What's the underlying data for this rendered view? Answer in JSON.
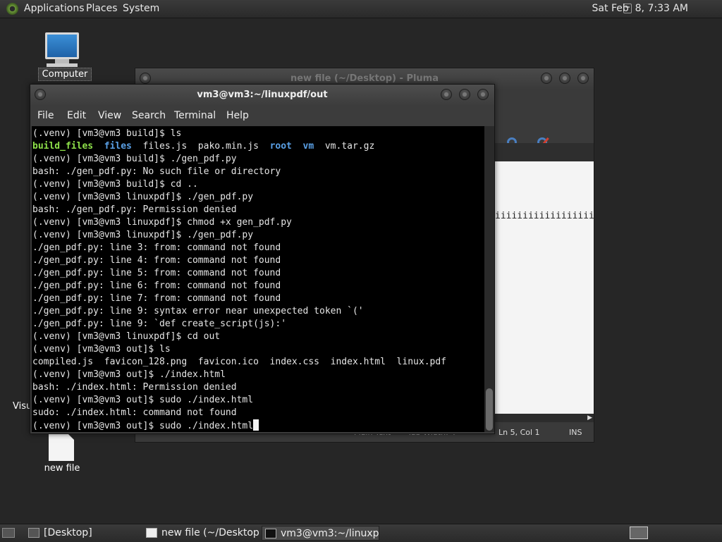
{
  "top_panel": {
    "menus": [
      "Applications",
      "Places",
      "System"
    ],
    "clock": "Sat Feb  8, 7:33 AM"
  },
  "desktop": {
    "computer_label": "Computer",
    "visu_label": "Visu",
    "newfile_label": "new file"
  },
  "pluma": {
    "title": "new file (~/Desktop) - Pluma",
    "text_line": "iiiiiiiiiiiiiiiiiiiii",
    "status": {
      "syntax": "Plain Text",
      "tab_width": "Tab Width:  4",
      "position": "Ln 5, Col 1",
      "mode": "INS"
    }
  },
  "terminal": {
    "title": "vm3@vm3:~/linuxpdf/out",
    "menus": [
      "File",
      "Edit",
      "View",
      "Search",
      "Terminal",
      "Help"
    ],
    "lines": [
      "(.venv) [vm3@vm3 build]$ ls",
      "build_files  files  files.js  pako.min.js  root  vm  vm.tar.gz",
      "(.venv) [vm3@vm3 build]$ ./gen_pdf.py",
      "bash: ./gen_pdf.py: No such file or directory",
      "(.venv) [vm3@vm3 build]$ cd ..",
      "(.venv) [vm3@vm3 linuxpdf]$ ./gen_pdf.py",
      "bash: ./gen_pdf.py: Permission denied",
      "(.venv) [vm3@vm3 linuxpdf]$ chmod +x gen_pdf.py",
      "(.venv) [vm3@vm3 linuxpdf]$ ./gen_pdf.py",
      "./gen_pdf.py: line 3: from: command not found",
      "./gen_pdf.py: line 4: from: command not found",
      "./gen_pdf.py: line 5: from: command not found",
      "./gen_pdf.py: line 6: from: command not found",
      "./gen_pdf.py: line 7: from: command not found",
      "./gen_pdf.py: line 9: syntax error near unexpected token `('",
      "./gen_pdf.py: line 9: `def create_script(js):'",
      "(.venv) [vm3@vm3 linuxpdf]$ cd out",
      "(.venv) [vm3@vm3 out]$ ls",
      "compiled.js  favicon_128.png  favicon.ico  index.css  index.html  linux.pdf",
      "(.venv) [vm3@vm3 out]$ ./index.html",
      "bash: ./index.html: Permission denied",
      "(.venv) [vm3@vm3 out]$ sudo ./index.html",
      "sudo: ./index.html: command not found",
      "(.venv) [vm3@vm3 out]$ sudo ./index.html"
    ],
    "ls_build": {
      "build_files": "build_files",
      "sep1": "  ",
      "files": "files",
      "mid": "  files.js  pako.min.js  ",
      "root": "root",
      "sep2": "  ",
      "vm": "vm",
      "tail": "  vm.tar.gz"
    }
  },
  "taskbar": {
    "tasks": [
      "[Desktop]",
      "new file (~/Desktop...",
      "vm3@vm3:~/linuxp..."
    ]
  },
  "colors": {
    "directory": "#5aa0e6",
    "executable": "#8ee04a"
  }
}
